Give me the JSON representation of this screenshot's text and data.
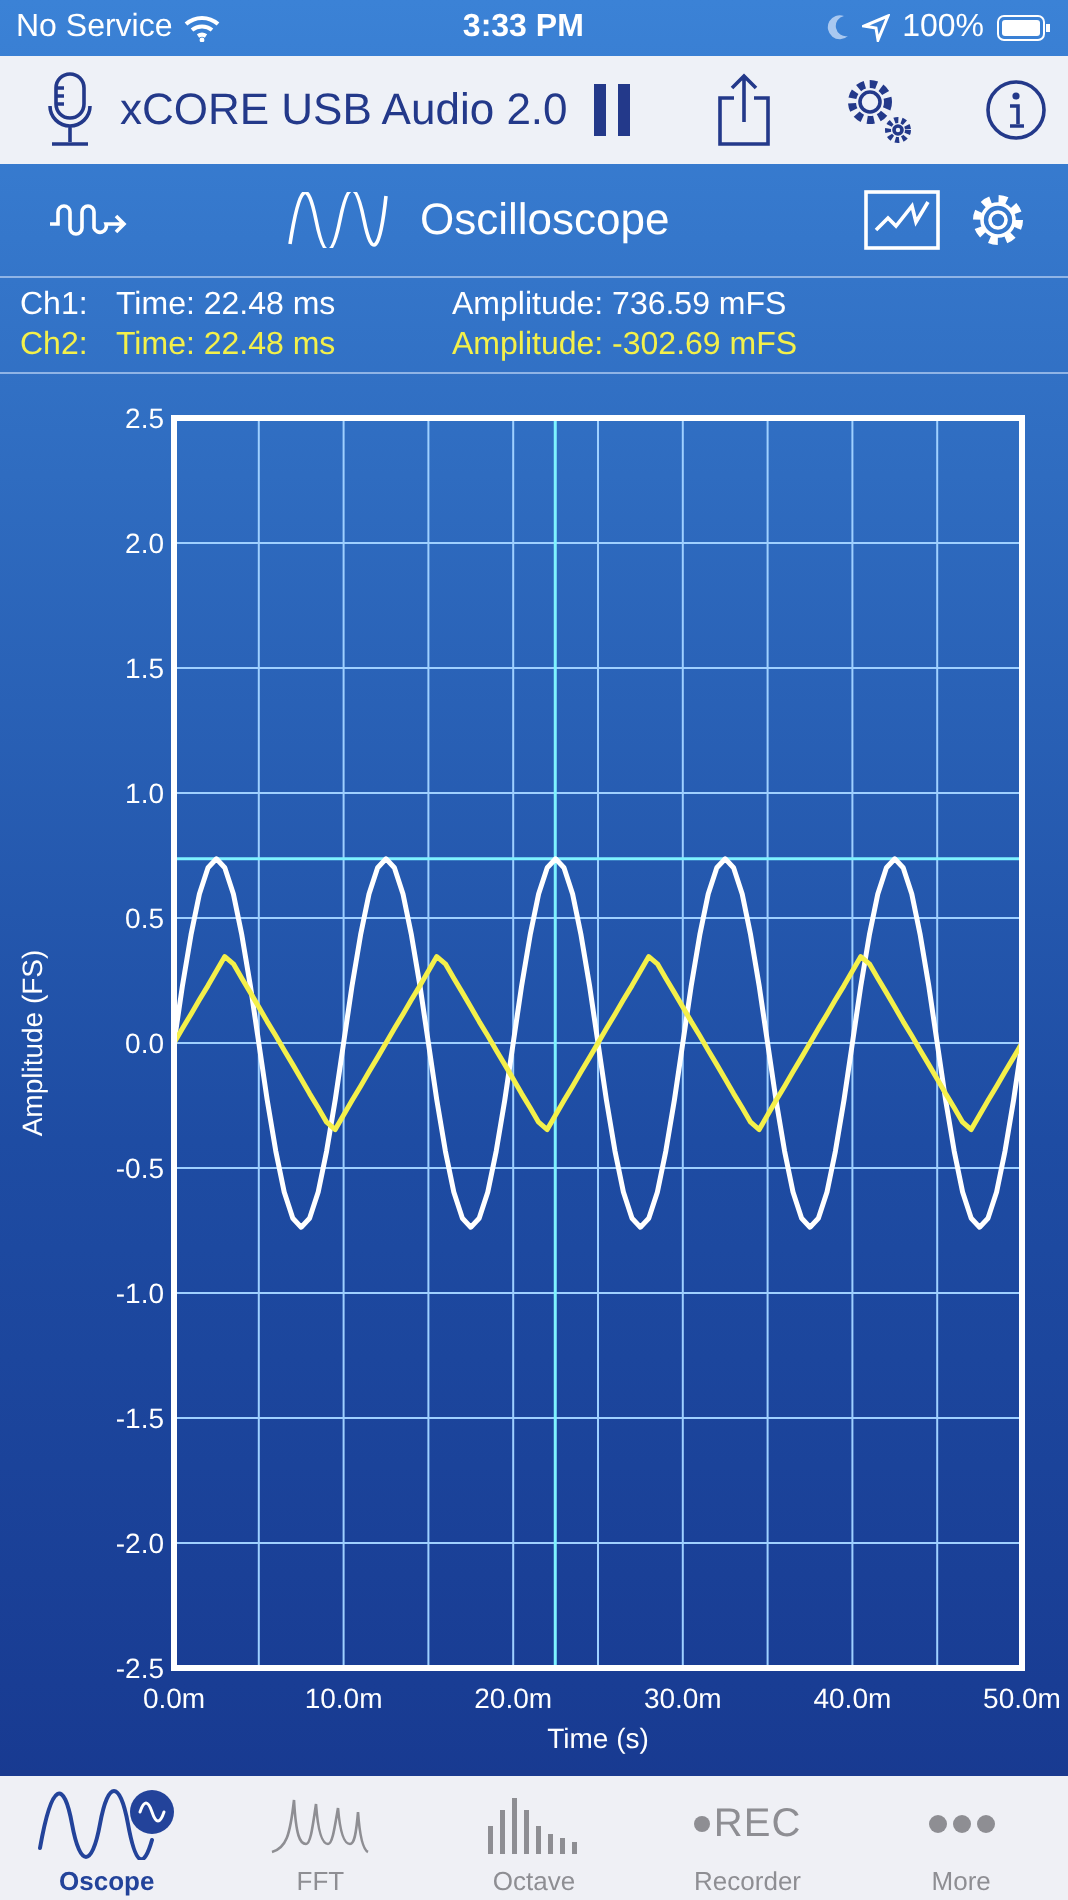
{
  "status_bar": {
    "carrier": "No Service",
    "time": "3:33 PM",
    "battery": "100%"
  },
  "header": {
    "device": "xCORE USB Audio 2.0"
  },
  "toolbar": {
    "title": "Oscilloscope"
  },
  "readouts": [
    {
      "channel": "Ch1:",
      "time": "Time: 22.48 ms",
      "amplitude": "Amplitude: 736.59 mFS",
      "color": "#ffffff"
    },
    {
      "channel": "Ch2:",
      "time": "Time: 22.48 ms",
      "amplitude": "Amplitude: -302.69 mFS",
      "color": "#f4f04a"
    }
  ],
  "chart_data": {
    "type": "line",
    "xlabel": "Time (s)",
    "ylabel": "Amplitude (FS)",
    "xlim": [
      0,
      50
    ],
    "ylim": [
      -2.5,
      2.5
    ],
    "xticks": [
      {
        "value": 0,
        "label": "0.0m"
      },
      {
        "value": 10,
        "label": "10.0m"
      },
      {
        "value": 20,
        "label": "20.0m"
      },
      {
        "value": 30,
        "label": "30.0m"
      },
      {
        "value": 40,
        "label": "40.0m"
      },
      {
        "value": 50,
        "label": "50.0m"
      }
    ],
    "yticks": [
      {
        "value": 2.5,
        "label": "2.5"
      },
      {
        "value": 2,
        "label": "2.0"
      },
      {
        "value": 1.5,
        "label": "1.5"
      },
      {
        "value": 1,
        "label": "1.0"
      },
      {
        "value": 0.5,
        "label": "0.5"
      },
      {
        "value": 0,
        "label": "0.0"
      },
      {
        "value": -0.5,
        "label": "-0.5"
      },
      {
        "value": -1,
        "label": "-1.0"
      },
      {
        "value": -1.5,
        "label": "-1.5"
      },
      {
        "value": -2,
        "label": "-2.0"
      },
      {
        "value": -2.5,
        "label": "-2.5"
      }
    ],
    "x": [
      0,
      0.5,
      1,
      1.5,
      2,
      2.5,
      3,
      3.5,
      4,
      4.5,
      5,
      5.5,
      6,
      6.5,
      7,
      7.5,
      8,
      8.5,
      9,
      9.5,
      10,
      10.5,
      11,
      11.5,
      12,
      12.5,
      13,
      13.5,
      14,
      14.5,
      15,
      15.5,
      16,
      16.5,
      17,
      17.5,
      18,
      18.5,
      19,
      19.5,
      20,
      20.5,
      21,
      21.5,
      22,
      22.5,
      23,
      23.5,
      24,
      24.5,
      25,
      25.5,
      26,
      26.5,
      27,
      27.5,
      28,
      28.5,
      29,
      29.5,
      30,
      30.5,
      31,
      31.5,
      32,
      32.5,
      33,
      33.5,
      34,
      34.5,
      35,
      35.5,
      36,
      36.5,
      37,
      37.5,
      38,
      38.5,
      39,
      39.5,
      40,
      40.5,
      41,
      41.5,
      42,
      42.5,
      43,
      43.5,
      44,
      44.5,
      45,
      45.5,
      46,
      46.5,
      47,
      47.5,
      48,
      48.5,
      49,
      49.5,
      50
    ],
    "series": [
      {
        "color": "#ffffff",
        "values": [
          0,
          0.228,
          0.433,
          0.596,
          0.701,
          0.737,
          0.701,
          0.596,
          0.433,
          0.228,
          0,
          -0.228,
          -0.433,
          -0.596,
          -0.701,
          -0.737,
          -0.701,
          -0.596,
          -0.433,
          -0.228,
          0,
          0.228,
          0.433,
          0.596,
          0.701,
          0.737,
          0.701,
          0.596,
          0.433,
          0.228,
          0,
          -0.228,
          -0.433,
          -0.596,
          -0.701,
          -0.737,
          -0.701,
          -0.596,
          -0.433,
          -0.228,
          0,
          0.228,
          0.433,
          0.596,
          0.701,
          0.737,
          0.701,
          0.596,
          0.433,
          0.228,
          0,
          -0.228,
          -0.433,
          -0.596,
          -0.701,
          -0.737,
          -0.701,
          -0.596,
          -0.433,
          -0.228,
          0,
          0.228,
          0.433,
          0.596,
          0.701,
          0.737,
          0.701,
          0.596,
          0.433,
          0.228,
          0,
          -0.228,
          -0.433,
          -0.596,
          -0.701,
          -0.737,
          -0.701,
          -0.596,
          -0.433,
          -0.228,
          0,
          0.228,
          0.433,
          0.596,
          0.701,
          0.737,
          0.701,
          0.596,
          0.433,
          0.228,
          0,
          -0.228,
          -0.433,
          -0.596,
          -0.701,
          -0.737,
          -0.701,
          -0.596,
          -0.433,
          -0.228,
          0
        ]
      },
      {
        "color": "#f4f04a",
        "values": [
          0,
          0.058,
          0.115,
          0.173,
          0.23,
          0.288,
          0.346,
          0.317,
          0.259,
          0.202,
          0.144,
          0.086,
          0.029,
          -0.029,
          -0.086,
          -0.144,
          -0.202,
          -0.259,
          -0.317,
          -0.346,
          -0.288,
          -0.23,
          -0.173,
          -0.115,
          -0.058,
          0,
          0.058,
          0.115,
          0.173,
          0.23,
          0.288,
          0.346,
          0.317,
          0.259,
          0.202,
          0.144,
          0.086,
          0.029,
          -0.029,
          -0.086,
          -0.144,
          -0.202,
          -0.259,
          -0.317,
          -0.346,
          -0.288,
          -0.23,
          -0.173,
          -0.115,
          -0.058,
          0,
          0.058,
          0.115,
          0.173,
          0.23,
          0.288,
          0.346,
          0.317,
          0.259,
          0.202,
          0.144,
          0.086,
          0.029,
          -0.029,
          -0.086,
          -0.144,
          -0.202,
          -0.259,
          -0.317,
          -0.346,
          -0.288,
          -0.23,
          -0.173,
          -0.115,
          -0.058,
          0,
          0.058,
          0.115,
          0.173,
          0.23,
          0.288,
          0.346,
          0.317,
          0.259,
          0.202,
          0.144,
          0.086,
          0.029,
          -0.029,
          -0.086,
          -0.144,
          -0.202,
          -0.259,
          -0.317,
          -0.346,
          -0.288,
          -0.23,
          -0.173,
          -0.115,
          -0.058,
          0
        ]
      }
    ],
    "grid": true,
    "ref_lines": [
      {
        "axis": "y",
        "value": 0.737,
        "color": "#7ef2ff"
      },
      {
        "axis": "x",
        "value": 22.48,
        "color": "#7ef2ff"
      }
    ]
  },
  "tabs": [
    {
      "label": "Oscope",
      "kind": "oscope",
      "selected": true
    },
    {
      "label": "FFT",
      "kind": "fft",
      "selected": false
    },
    {
      "label": "Octave",
      "kind": "octave",
      "selected": false
    },
    {
      "label": "Recorder",
      "kind": "recorder",
      "icon_text": "REC",
      "selected": false
    },
    {
      "label": "More",
      "kind": "more",
      "selected": false
    }
  ]
}
